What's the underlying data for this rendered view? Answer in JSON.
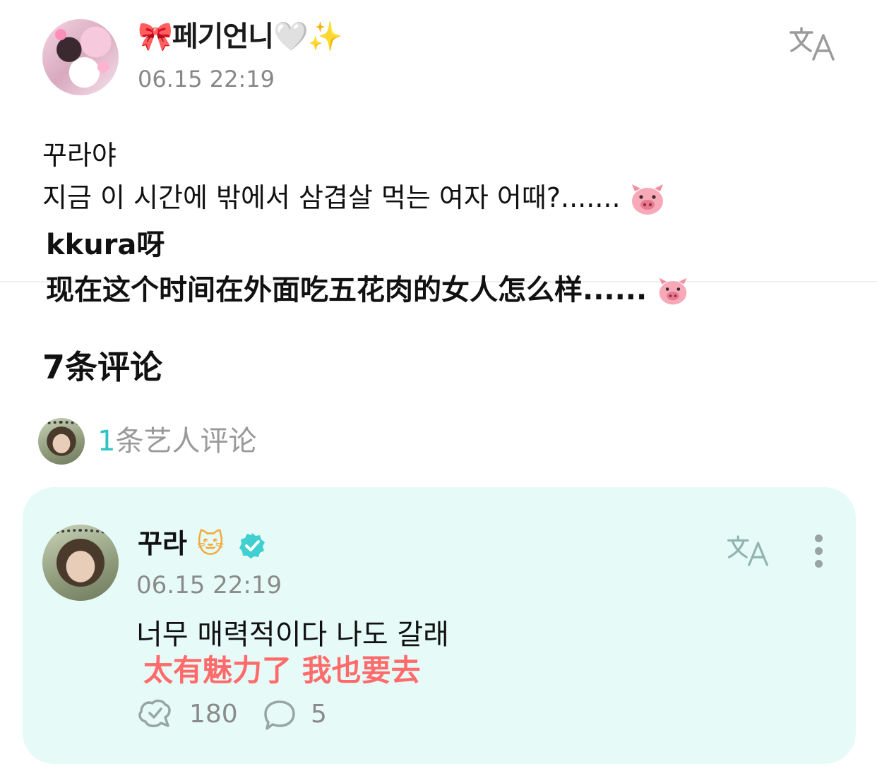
{
  "post": {
    "author": {
      "name": "페기언니",
      "bow_emoji": "🎀",
      "heart_emoji": "🤍",
      "sparkle_emoji": "✨"
    },
    "timestamp": "06.15 22:19",
    "lines": [
      "꾸라야",
      "지금 이 시간에 밖에서 삼겹살 먹는 여자 어때?......."
    ],
    "translation_lines": [
      "kkura呀",
      "现在这个时间在外面吃五花肉的女人怎么样......"
    ]
  },
  "comments": {
    "count_label": "7条评论",
    "artist_count": "1",
    "artist_label": "条艺人评论"
  },
  "comment": {
    "author_name": "꾸라",
    "cat_emoji": "🐱",
    "timestamp": "06.15 22:19",
    "text": "너무 매력적이다 나도 갈래",
    "translation": "太有魅力了 我也要去",
    "likes": "180",
    "replies": "5"
  },
  "icons": {
    "translate": "translate-icon",
    "more": "more-vertical-icon",
    "like": "like-icon",
    "reply": "reply-bubble-icon",
    "verified": "verified-badge-icon",
    "pig": "pig-face-icon"
  },
  "colors": {
    "accent": "#2ec4c4",
    "card_background": "#e6fbf8",
    "translation_text": "#ff6b6b",
    "muted_text": "#888888"
  }
}
